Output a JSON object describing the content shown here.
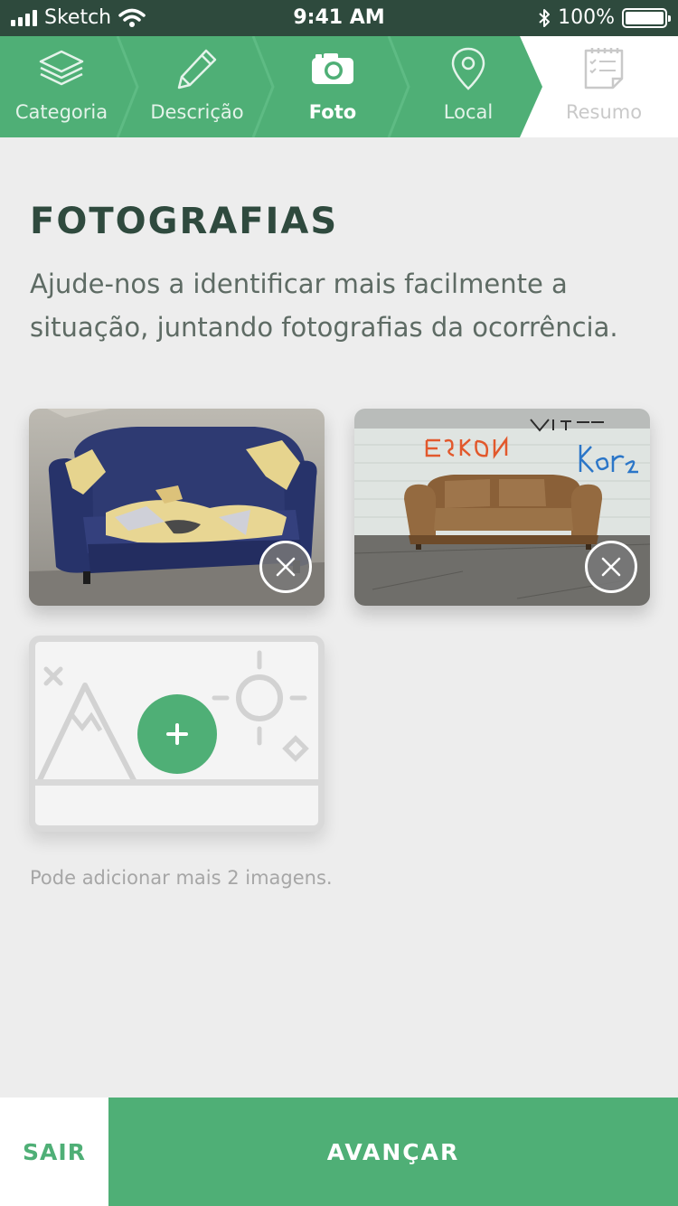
{
  "status_bar": {
    "carrier": "Sketch",
    "time": "9:41 AM",
    "battery": "100%",
    "icons": [
      "signal-icon",
      "wifi-icon",
      "bluetooth-icon",
      "battery-icon"
    ]
  },
  "stepper": {
    "steps": [
      {
        "label": "Categoria",
        "icon": "layers-icon",
        "state": "done"
      },
      {
        "label": "Descrição",
        "icon": "pencil-icon",
        "state": "done"
      },
      {
        "label": "Foto",
        "icon": "camera-icon",
        "state": "active"
      },
      {
        "label": "Local",
        "icon": "location-pin-icon",
        "state": "done"
      },
      {
        "label": "Resumo",
        "icon": "checklist-icon",
        "state": "disabled"
      }
    ]
  },
  "main": {
    "title": "FOTOGRAFIAS",
    "description": "Ajude-nos a identificar mais facilmente a situação, juntando fotografias da ocorrência.",
    "photos": [
      {
        "subject": "blue-torn-sofa-photo"
      },
      {
        "subject": "brown-sofa-graffiti-photo"
      }
    ],
    "add_photo_icon": "plus-icon",
    "hint": "Pode adicionar mais 2 imagens."
  },
  "footer": {
    "exit_label": "SAIR",
    "next_label": "AVANÇAR"
  },
  "colors": {
    "accent": "#4faf76",
    "status_bar": "#2e4a3d",
    "title": "#2f4a3e",
    "background": "#ededed"
  }
}
